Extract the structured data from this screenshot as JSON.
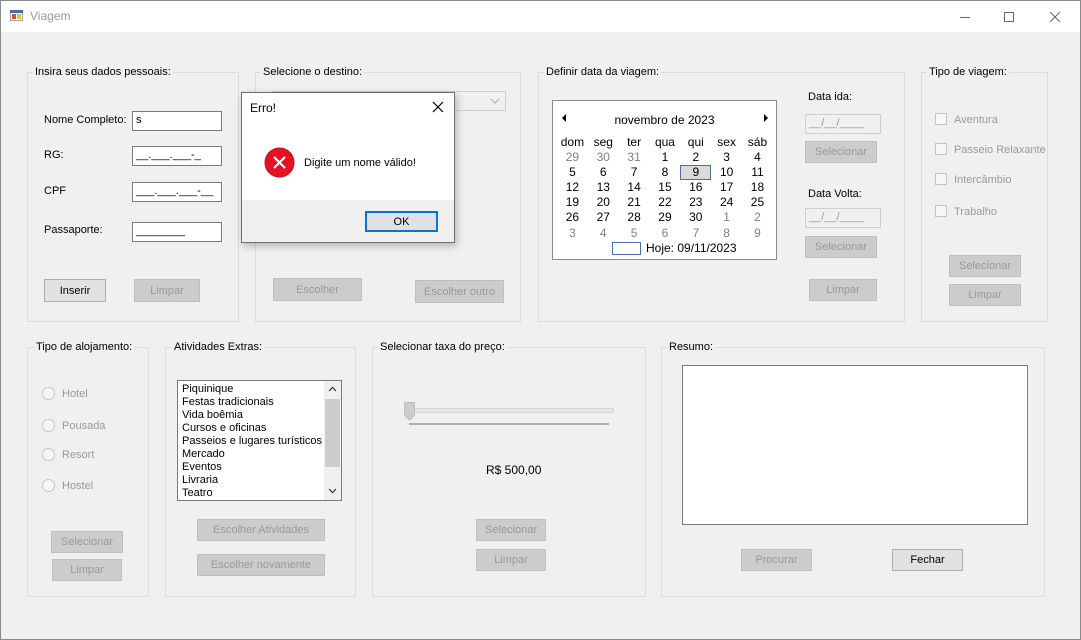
{
  "window": {
    "title": "Viagem",
    "minimize_icon": "minimize-icon",
    "maximize_icon": "maximize-icon",
    "close_icon": "close-icon"
  },
  "personal": {
    "group_label": "Insira seus dados pessoais:",
    "name_label": "Nome Completo:",
    "name_value": "s",
    "rg_label": "RG:",
    "rg_value": "__.___.___-_",
    "cpf_label": "CPF",
    "cpf_value": "___.___.___-__",
    "passport_label": "Passaporte:",
    "passport_value": "________",
    "insert_button": "Inserir",
    "clear_button": "Limpar"
  },
  "destination": {
    "group_label": "Selecione o destino:",
    "choose_button": "Escolher",
    "choose_other_button": "Escolher outro"
  },
  "date": {
    "group_label": "Definir data da viagem:",
    "calendar": {
      "month_label": "novembro de 2023",
      "days_of_week": [
        "dom",
        "seg",
        "ter",
        "qua",
        "qui",
        "sex",
        "sáb"
      ],
      "weeks": [
        [
          "29",
          "30",
          "31",
          "1",
          "2",
          "3",
          "4"
        ],
        [
          "5",
          "6",
          "7",
          "8",
          "9",
          "10",
          "11"
        ],
        [
          "12",
          "13",
          "14",
          "15",
          "16",
          "17",
          "18"
        ],
        [
          "19",
          "20",
          "21",
          "22",
          "23",
          "24",
          "25"
        ],
        [
          "26",
          "27",
          "28",
          "29",
          "30",
          "1",
          "2"
        ],
        [
          "3",
          "4",
          "5",
          "6",
          "7",
          "8",
          "9"
        ]
      ],
      "selected_day": "9",
      "today_label": "Hoje: 09/11/2023"
    },
    "departure_label": "Data ida:",
    "departure_value": "__/__/____",
    "departure_select_button": "Selecionar",
    "return_label": "Data Volta:",
    "return_value": "__/__/____",
    "return_select_button": "Selecionar",
    "clear_button": "Limpar"
  },
  "trip_type": {
    "group_label": "Tipo de viagem:",
    "options": [
      "Aventura",
      "Passeio Relaxante",
      "Intercâmbio",
      "Trabalho"
    ],
    "select_button": "Selecionar",
    "clear_button": "Limpar"
  },
  "lodging": {
    "group_label": "Tipo de alojamento:",
    "options": [
      "Hotel",
      "Pousada",
      "Resort",
      "Hostel"
    ],
    "select_button": "Selecionar",
    "clear_button": "Limpar"
  },
  "activities": {
    "group_label": "Atividades Extras:",
    "items": [
      "Piquinique",
      "Festas tradicionais",
      "Vida boêmia",
      "Cursos e oficinas",
      "Passeios e lugares turísticos",
      "Mercado",
      "Eventos",
      "Livraria",
      "Teatro"
    ],
    "choose_button": "Escolher Atividades",
    "choose_again_button": "Escolher novamente"
  },
  "price": {
    "group_label": "Selecionar taxa do preço:",
    "value_label": "R$ 500,00",
    "slider_fraction": 0,
    "select_button": "Selecionar",
    "clear_button": "Limpar"
  },
  "summary": {
    "group_label": "Resumo:",
    "search_button": "Procurar",
    "close_button": "Fechar"
  },
  "dialog": {
    "title": "Erro!",
    "message": "Digite um nome válido!",
    "ok_button": "OK",
    "error_icon": "error-icon",
    "error_color": "#e81123"
  }
}
